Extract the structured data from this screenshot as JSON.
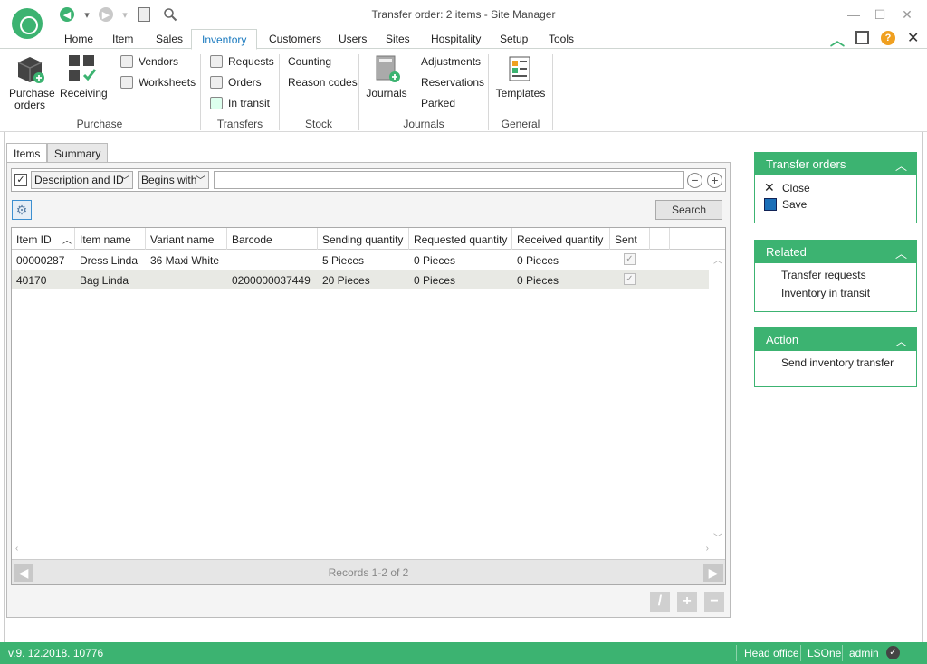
{
  "window": {
    "title": "Transfer order: 2 items - Site Manager"
  },
  "menu": {
    "tabs": [
      "Home",
      "Item",
      "Sales",
      "Inventory",
      "Customers",
      "Users",
      "Sites",
      "Hospitality",
      "Setup",
      "Tools"
    ],
    "active": "Inventory"
  },
  "ribbon": {
    "purchase": {
      "label": "Purchase",
      "purchase_orders": "Purchase\norders",
      "receiving": "Receiving",
      "vendors": "Vendors",
      "worksheets": "Worksheets"
    },
    "transfers": {
      "label": "Transfers",
      "requests": "Requests",
      "orders": "Orders",
      "in_transit": "In transit"
    },
    "stock": {
      "label": "Stock",
      "counting": "Counting",
      "reason_codes": "Reason codes"
    },
    "journals": {
      "label": "Journals",
      "journals": "Journals",
      "adjustments": "Adjustments",
      "reservations": "Reservations",
      "parked": "Parked"
    },
    "general": {
      "label": "General",
      "templates": "Templates"
    }
  },
  "panel_tabs": [
    "Items",
    "Summary"
  ],
  "filter": {
    "field": "Description and ID",
    "operator": "Begins with",
    "value": "",
    "checked": true
  },
  "search_button": "Search",
  "grid": {
    "columns": [
      "Item ID",
      "Item name",
      "Variant name",
      "Barcode",
      "Sending quantity",
      "Requested quantity",
      "Received quantity",
      "Sent"
    ],
    "rows": [
      {
        "item_id": "00000287",
        "item_name": "Dress Linda",
        "variant": "36 Maxi White",
        "barcode": "",
        "sending": "5 Pieces",
        "requested": "0 Pieces",
        "received": "0 Pieces",
        "sent": true
      },
      {
        "item_id": "40170",
        "item_name": "Bag Linda",
        "variant": "",
        "barcode": "0200000037449",
        "sending": "20 Pieces",
        "requested": "0 Pieces",
        "received": "0 Pieces",
        "sent": true
      }
    ],
    "records": "Records 1-2 of 2"
  },
  "side": {
    "transfer_orders": {
      "title": "Transfer orders",
      "close": "Close",
      "save": "Save"
    },
    "related": {
      "title": "Related",
      "items": [
        "Transfer requests",
        "Inventory in transit"
      ]
    },
    "action": {
      "title": "Action",
      "items": [
        "Send inventory transfer"
      ]
    }
  },
  "status": {
    "version": "v.9. 12.2018. 10776",
    "store": "Head office",
    "company": "LSOne",
    "user": "admin"
  },
  "colors": {
    "accent": "#3cb371",
    "selected_tab": "#1b7abf"
  }
}
